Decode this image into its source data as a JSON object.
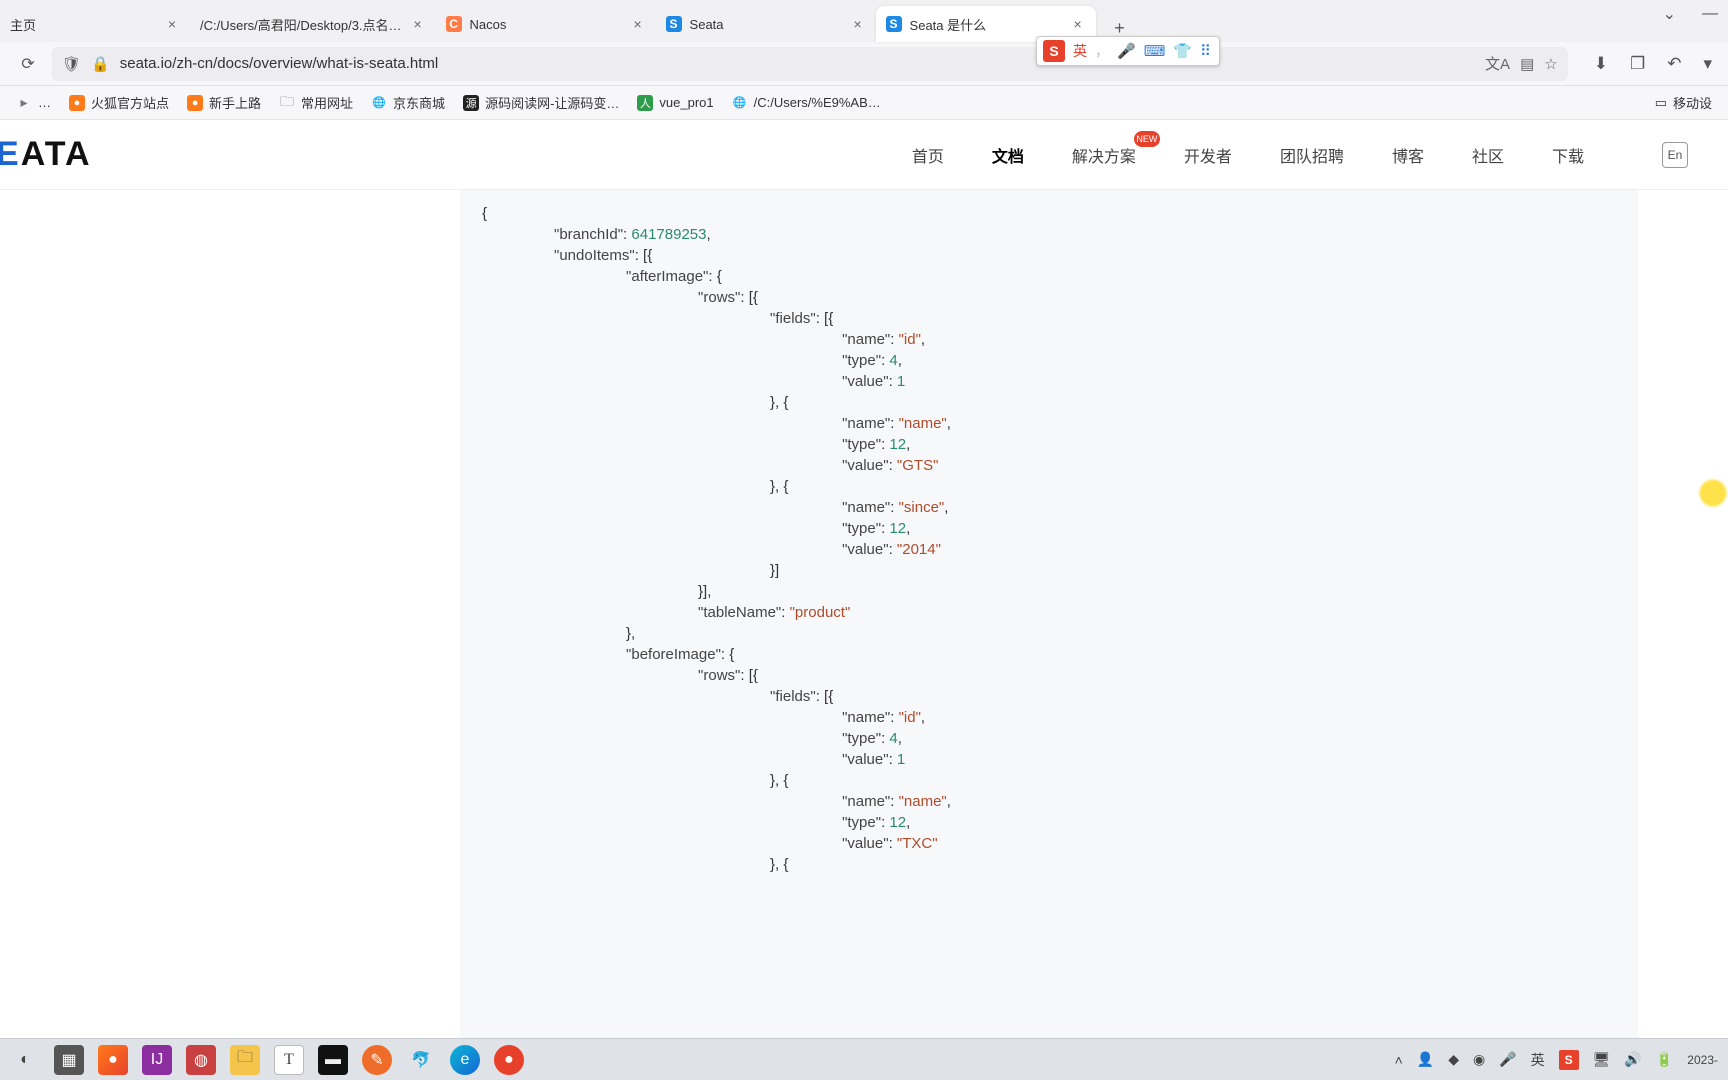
{
  "tabs": [
    {
      "title": "主页"
    },
    {
      "title": "/C:/Users/高君阳/Desktop/3.点名…"
    },
    {
      "title": "Nacos"
    },
    {
      "title": "Seata"
    },
    {
      "title": "Seata 是什么"
    }
  ],
  "url": "seata.io/zh-cn/docs/overview/what-is-seata.html",
  "bookmarks": [
    {
      "label": "…"
    },
    {
      "label": "火狐官方站点"
    },
    {
      "label": "新手上路"
    },
    {
      "label": "常用网址"
    },
    {
      "label": "京东商城"
    },
    {
      "label": "源码阅读网-让源码变…"
    },
    {
      "label": "vue_pro1"
    },
    {
      "label": "/C:/Users/%E9%AB…"
    }
  ],
  "bookmarks_right": "移动设",
  "ime": {
    "lang": "英",
    "punct": "，"
  },
  "logo": {
    "e": "E",
    "rest": "ATA"
  },
  "nav": {
    "home": "首页",
    "docs": "文档",
    "solution": "解决方案",
    "badge": "NEW",
    "dev": "开发者",
    "jobs": "团队招聘",
    "blog": "博客",
    "community": "社区",
    "download": "下载",
    "lang": "En"
  },
  "chart_data": {
    "type": "code-json",
    "branchId": 641789253,
    "undoItems": [
      {
        "afterImage": {
          "rows": [
            {
              "fields": [
                {
                  "name": "id",
                  "type": 4,
                  "value": 1
                },
                {
                  "name": "name",
                  "type": 12,
                  "value": "GTS"
                },
                {
                  "name": "since",
                  "type": 12,
                  "value": "2014"
                }
              ]
            }
          ],
          "tableName": "product"
        },
        "beforeImage": {
          "rows": [
            {
              "fields": [
                {
                  "name": "id",
                  "type": 4,
                  "value": 1
                },
                {
                  "name": "name",
                  "type": 12,
                  "value": "TXC"
                }
              ]
            }
          ]
        }
      }
    ]
  },
  "code": {
    "l1": "{",
    "l2a": "\"branchId\"",
    "l2b": ": ",
    "l2c": "641789253",
    "l2d": ",",
    "l3a": "\"undoItems\"",
    "l3b": ": [{",
    "l4a": "\"afterImage\"",
    "l4b": ": {",
    "l5a": "\"rows\"",
    "l5b": ": [{",
    "l6a": "\"fields\"",
    "l6b": ": [{",
    "k_name": "\"name\"",
    "k_type": "\"type\"",
    "k_value": "\"value\"",
    "v_id": "\"id\"",
    "n4": "4",
    "n1": "1",
    "close_field": "}, {",
    "v_name": "\"name\"",
    "n12": "12",
    "v_gts": "\"GTS\"",
    "v_since": "\"since\"",
    "v_2014": "\"2014\"",
    "close_fields": "}]",
    "close_rows": "}],",
    "k_table": "\"tableName\"",
    "v_product": "\"product\"",
    "close_after": "},",
    "k_before": "\"beforeImage\"",
    "open_obj": ": {",
    "v_txc": "\"TXC\"",
    "colon": ": ",
    "comma": ",",
    "close_field_open": "}, {"
  },
  "taskbar_date": "2023-"
}
